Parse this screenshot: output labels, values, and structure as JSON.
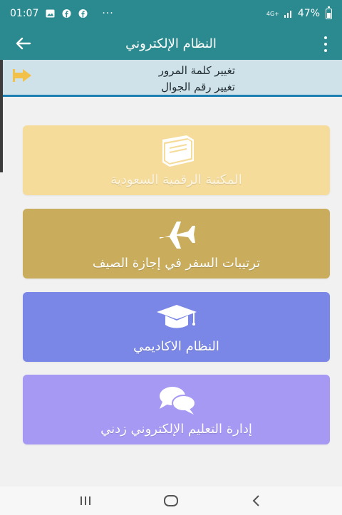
{
  "status_bar": {
    "time": "01:07",
    "dots": "···",
    "network": "4G+",
    "battery_percent": "47%",
    "battery_level": 0.47
  },
  "app_bar": {
    "title": "النظام الإلكتروني"
  },
  "sub_header": {
    "change_password": "تغيير كلمة المرور",
    "change_mobile": "تغيير رقم الجوال"
  },
  "cards": {
    "library": "المكتبة الرقمية السعودية",
    "travel": "ترتيبات السفر في إجازة الصيف",
    "academic": "النظام الاكاديمي",
    "elearning": "إدارة التعليم الإلكتروني زدني"
  },
  "colors": {
    "primary": "#2b8a8f",
    "library": "#f6dc9b",
    "travel": "#c9ad5c",
    "academic": "#7b87e6",
    "elearning": "#a699f4"
  },
  "icons": {
    "back": "arrow-left-icon",
    "menu": "more-vertical-icon",
    "logout": "logout-arrow-icon",
    "library": "book-icon",
    "travel": "airplane-icon",
    "academic": "graduation-cap-icon",
    "elearning": "chat-bubbles-icon"
  }
}
